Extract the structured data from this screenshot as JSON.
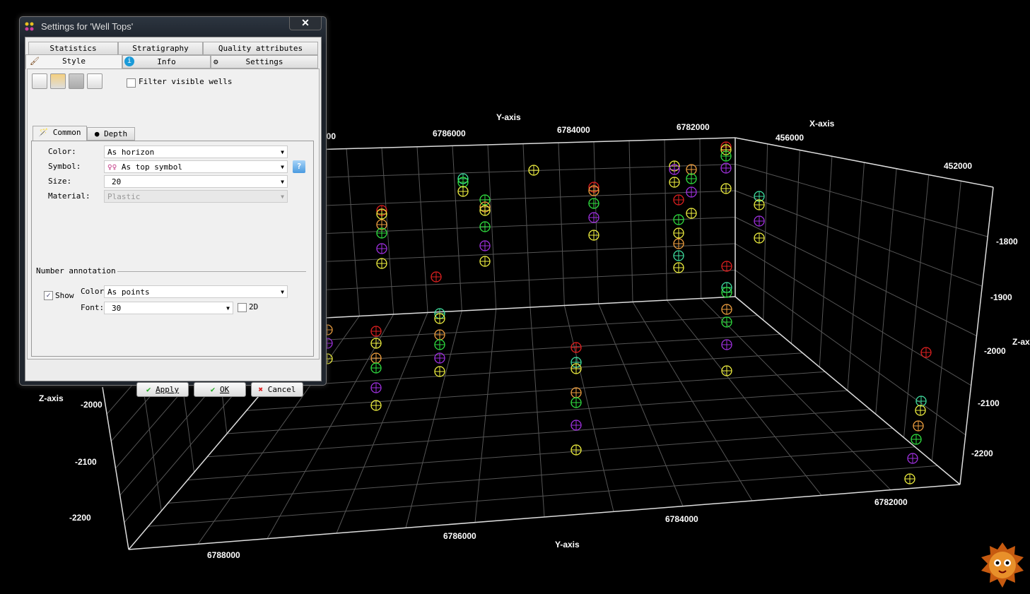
{
  "viewer": {
    "top_axis_title": "Y-axis",
    "top_ticks": [
      "000",
      "6786000",
      "6784000",
      "6782000"
    ],
    "x_axis_title": "X-axis",
    "x_ticks": [
      "456000",
      "452000"
    ],
    "right_z_title": "Z-ax",
    "right_z_ticks": [
      "-1800",
      "-1900",
      "-2000",
      "-2100",
      "-2200"
    ],
    "left_z_title": "Z-axis",
    "left_z_ticks": [
      "-2000",
      "-2100",
      "-2200"
    ],
    "bottom_axis_title": "Y-axis",
    "bottom_ticks": [
      "6788000",
      "6786000",
      "6784000",
      "6782000"
    ],
    "colors": {
      "background": "#000000",
      "red": "#e02020",
      "orange": "#f0a040",
      "green": "#30e040",
      "teal": "#40e0a0",
      "purple": "#a030e0",
      "yellow": "#f0f040"
    }
  },
  "dialog": {
    "title": "Settings for 'Well Tops'",
    "close": "✕",
    "tabs_row1": [
      "Statistics",
      "Stratigraphy",
      "Quality attributes"
    ],
    "tabs_row2": [
      "Style",
      "Info",
      "Settings"
    ],
    "filter_visible_wells": {
      "label": "Filter visible wells",
      "checked": false
    },
    "subtabs": [
      "Common",
      "Depth"
    ],
    "fields": {
      "color": {
        "label": "Color:",
        "value": "As horizon"
      },
      "symbol": {
        "label": "Symbol:",
        "value": "As top symbol"
      },
      "size": {
        "label": "Size:",
        "value": "20"
      },
      "material": {
        "label": "Material:",
        "value": "Plastic"
      }
    },
    "help": "?",
    "number_annotation": {
      "title": "Number annotation",
      "show": {
        "label": "Show",
        "checked": true
      },
      "color_label": "Color",
      "color_value": "As points",
      "font_label": "Font:",
      "font_value": "30",
      "two_d": {
        "label": "2D",
        "checked": false
      }
    },
    "buttons": {
      "apply": "Apply",
      "ok": "OK",
      "cancel": "Cancel"
    }
  }
}
